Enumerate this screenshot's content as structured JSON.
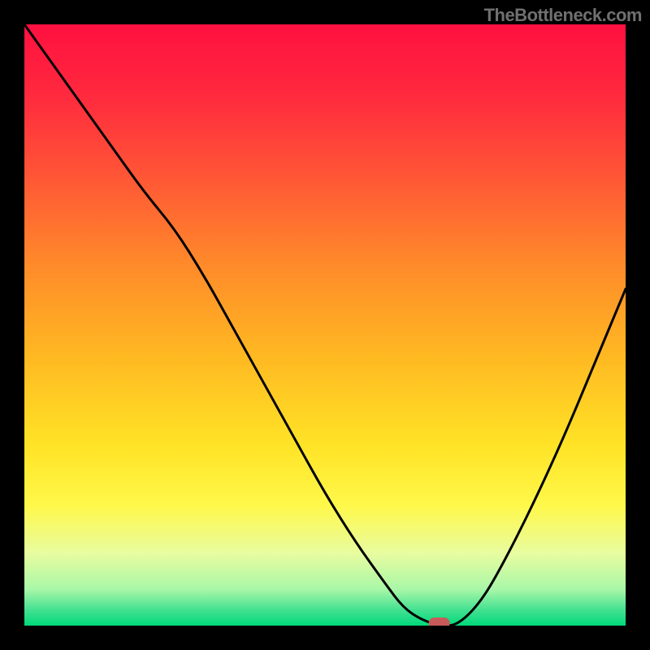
{
  "watermark": "TheBottleneck.com",
  "chart_data": {
    "type": "line",
    "title": "",
    "xlabel": "",
    "ylabel": "",
    "xlim": [
      0,
      100
    ],
    "ylim": [
      0,
      100
    ],
    "grid": false,
    "series": [
      {
        "name": "bottleneck-curve",
        "x": [
          0,
          5,
          10,
          15,
          20,
          25,
          30,
          35,
          40,
          45,
          50,
          55,
          60,
          63,
          66,
          69,
          72,
          76,
          80,
          85,
          90,
          95,
          100
        ],
        "y": [
          100,
          93,
          86,
          79,
          72,
          66,
          58,
          49,
          40,
          31,
          22,
          14,
          7,
          3,
          1,
          0,
          0,
          4,
          11,
          21,
          32,
          44,
          56
        ]
      }
    ],
    "marker": {
      "x": 69,
      "y": 0,
      "color": "#c95a5a"
    },
    "background_gradient": {
      "stops": [
        {
          "offset": 0.0,
          "color": "#ff1040"
        },
        {
          "offset": 0.12,
          "color": "#ff2a3e"
        },
        {
          "offset": 0.25,
          "color": "#ff5536"
        },
        {
          "offset": 0.4,
          "color": "#ff8a2a"
        },
        {
          "offset": 0.55,
          "color": "#ffb822"
        },
        {
          "offset": 0.7,
          "color": "#ffe326"
        },
        {
          "offset": 0.8,
          "color": "#fff84a"
        },
        {
          "offset": 0.88,
          "color": "#e8fca0"
        },
        {
          "offset": 0.94,
          "color": "#a8f7a8"
        },
        {
          "offset": 0.975,
          "color": "#40e090"
        },
        {
          "offset": 1.0,
          "color": "#00d97a"
        }
      ]
    }
  }
}
